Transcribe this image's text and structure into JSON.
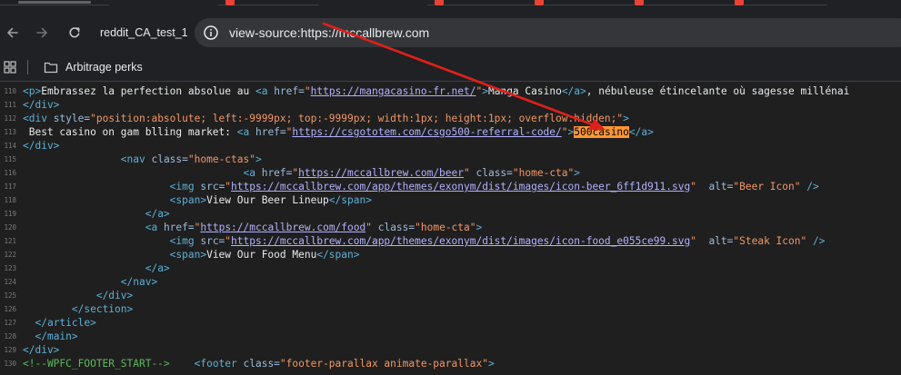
{
  "browser": {
    "profile_name": "reddit_CA_test_1",
    "url": "view-source:https://mccallbrew.com",
    "bookmark_folder": "Arbitrage perks"
  },
  "colors": {
    "annotation_arrow": "#e0201b",
    "search_highlight": "#ff9632"
  },
  "source_lines": [
    {
      "n": "110",
      "indent": "",
      "parts": [
        {
          "t": "<p>",
          "c": "tag"
        },
        {
          "t": "Embrassez la perfection absolue au ",
          "c": "text"
        },
        {
          "t": "<a ",
          "c": "tag"
        },
        {
          "t": "href=",
          "c": "attr"
        },
        {
          "t": "\"",
          "c": "val"
        },
        {
          "t": "https://mangacasino-fr.net/",
          "c": "link"
        },
        {
          "t": "\"",
          "c": "val"
        },
        {
          "t": ">",
          "c": "tag"
        },
        {
          "t": "Manga Casino",
          "c": "text"
        },
        {
          "t": "</a>",
          "c": "tag"
        },
        {
          "t": ", nébuleuse étincelante où sagesse millénai",
          "c": "text"
        }
      ]
    },
    {
      "n": "111",
      "indent": "",
      "parts": [
        {
          "t": "</div>",
          "c": "tag"
        }
      ]
    },
    {
      "n": "112",
      "indent": "",
      "parts": [
        {
          "t": "<div ",
          "c": "tag"
        },
        {
          "t": "style=",
          "c": "attr"
        },
        {
          "t": "\"position:absolute; left:-9999px; top:-9999px; width:1px; height:1px; overflow:hidden;\"",
          "c": "val"
        },
        {
          "t": ">",
          "c": "tag"
        }
      ]
    },
    {
      "n": "113",
      "indent": "",
      "parts": [
        {
          "t": " Best casino on gam blling market: ",
          "c": "text"
        },
        {
          "t": "<a ",
          "c": "tag"
        },
        {
          "t": "href=",
          "c": "attr"
        },
        {
          "t": "\"",
          "c": "val"
        },
        {
          "t": "https://csgototem.com/csgo500-referral-code/",
          "c": "link"
        },
        {
          "t": "\"",
          "c": "val"
        },
        {
          "t": ">",
          "c": "tag"
        },
        {
          "t": "500casino",
          "c": "hl"
        },
        {
          "t": "</a>",
          "c": "tag"
        }
      ]
    },
    {
      "n": "114",
      "indent": "",
      "parts": [
        {
          "t": "</div>",
          "c": "tag"
        }
      ]
    },
    {
      "n": "115",
      "indent": "                ",
      "parts": [
        {
          "t": "<nav ",
          "c": "tag"
        },
        {
          "t": "class=",
          "c": "attr"
        },
        {
          "t": "\"home-ctas\"",
          "c": "val"
        },
        {
          "t": ">",
          "c": "tag"
        }
      ]
    },
    {
      "n": "116",
      "indent": "                                    ",
      "parts": [
        {
          "t": "<a ",
          "c": "tag"
        },
        {
          "t": "href=",
          "c": "attr"
        },
        {
          "t": "\"",
          "c": "val"
        },
        {
          "t": "https://mccallbrew.com/beer",
          "c": "link"
        },
        {
          "t": "\"",
          "c": "val"
        },
        {
          "t": " class=",
          "c": "attr"
        },
        {
          "t": "\"home-cta\"",
          "c": "val"
        },
        {
          "t": ">",
          "c": "tag"
        }
      ]
    },
    {
      "n": "117",
      "indent": "                        ",
      "parts": [
        {
          "t": "<img ",
          "c": "tag"
        },
        {
          "t": "src=",
          "c": "attr"
        },
        {
          "t": "\"",
          "c": "val"
        },
        {
          "t": "https://mccallbrew.com/app/themes/exonym/dist/images/icon-beer_6ff1d911.svg",
          "c": "link"
        },
        {
          "t": "\"",
          "c": "val"
        },
        {
          "t": "  alt=",
          "c": "attr"
        },
        {
          "t": "\"Beer Icon\"",
          "c": "val"
        },
        {
          "t": " />",
          "c": "tag"
        }
      ]
    },
    {
      "n": "118",
      "indent": "                        ",
      "parts": [
        {
          "t": "<span>",
          "c": "tag"
        },
        {
          "t": "View Our Beer Lineup",
          "c": "text"
        },
        {
          "t": "</span>",
          "c": "tag"
        }
      ]
    },
    {
      "n": "119",
      "indent": "                    ",
      "parts": [
        {
          "t": "</a>",
          "c": "tag"
        }
      ]
    },
    {
      "n": "120",
      "indent": "                    ",
      "parts": [
        {
          "t": "<a ",
          "c": "tag"
        },
        {
          "t": "href=",
          "c": "attr"
        },
        {
          "t": "\"",
          "c": "val"
        },
        {
          "t": "https://mccallbrew.com/food",
          "c": "link"
        },
        {
          "t": "\"",
          "c": "val"
        },
        {
          "t": " class=",
          "c": "attr"
        },
        {
          "t": "\"home-cta\"",
          "c": "val"
        },
        {
          "t": ">",
          "c": "tag"
        }
      ]
    },
    {
      "n": "121",
      "indent": "                        ",
      "parts": [
        {
          "t": "<img ",
          "c": "tag"
        },
        {
          "t": "src=",
          "c": "attr"
        },
        {
          "t": "\"",
          "c": "val"
        },
        {
          "t": "https://mccallbrew.com/app/themes/exonym/dist/images/icon-food_e055ce99.svg",
          "c": "link"
        },
        {
          "t": "\"",
          "c": "val"
        },
        {
          "t": "  alt=",
          "c": "attr"
        },
        {
          "t": "\"Steak Icon\"",
          "c": "val"
        },
        {
          "t": " />",
          "c": "tag"
        }
      ]
    },
    {
      "n": "122",
      "indent": "                        ",
      "parts": [
        {
          "t": "<span>",
          "c": "tag"
        },
        {
          "t": "View Our Food Menu",
          "c": "text"
        },
        {
          "t": "</span>",
          "c": "tag"
        }
      ]
    },
    {
      "n": "123",
      "indent": "                    ",
      "parts": [
        {
          "t": "</a>",
          "c": "tag"
        }
      ]
    },
    {
      "n": "124",
      "indent": "                ",
      "parts": [
        {
          "t": "</nav>",
          "c": "tag"
        }
      ]
    },
    {
      "n": "125",
      "indent": "            ",
      "parts": [
        {
          "t": "</div>",
          "c": "tag"
        }
      ]
    },
    {
      "n": "126",
      "indent": "        ",
      "parts": [
        {
          "t": "</section>",
          "c": "tag"
        }
      ]
    },
    {
      "n": "127",
      "indent": "  ",
      "parts": [
        {
          "t": "</article>",
          "c": "tag"
        }
      ]
    },
    {
      "n": "128",
      "indent": "  ",
      "parts": [
        {
          "t": "</main>",
          "c": "tag"
        }
      ]
    },
    {
      "n": "129",
      "indent": "",
      "parts": [
        {
          "t": "</div>",
          "c": "tag"
        }
      ]
    },
    {
      "n": "130",
      "indent": "",
      "parts": [
        {
          "t": "<!--WPFC_FOOTER_START-->",
          "c": "comment"
        },
        {
          "t": "    ",
          "c": "text"
        },
        {
          "t": "<footer ",
          "c": "tag"
        },
        {
          "t": "class=",
          "c": "attr"
        },
        {
          "t": "\"footer-parallax animate-parallax\"",
          "c": "val"
        },
        {
          "t": ">",
          "c": "tag"
        }
      ]
    }
  ]
}
